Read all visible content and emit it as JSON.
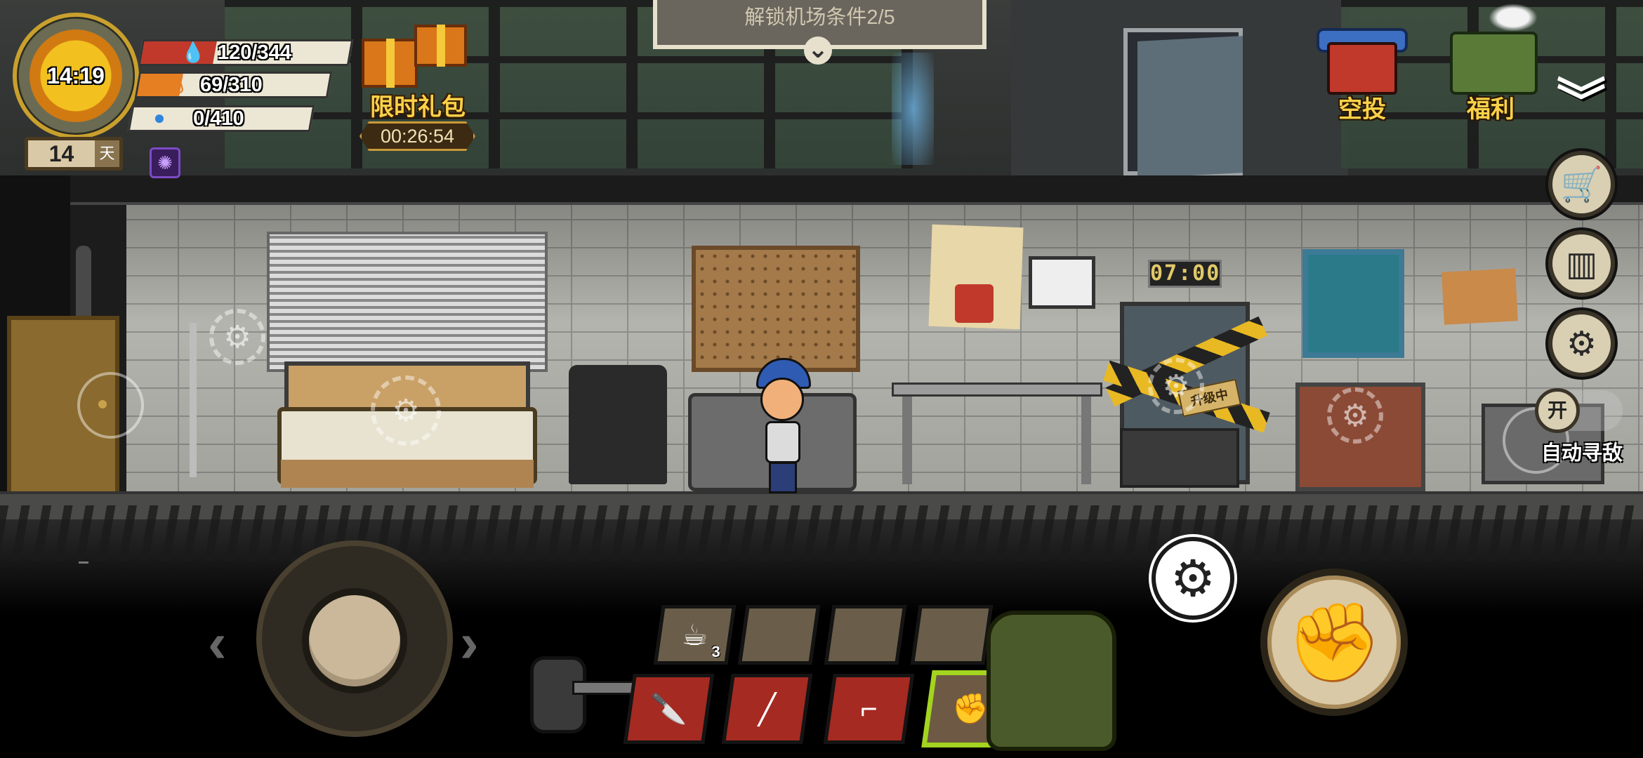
{
  "hud": {
    "clock_time": "14:19",
    "day": {
      "number": "14",
      "unit": "天"
    },
    "stats": [
      {
        "name": "health",
        "value": "120/344",
        "fraction": 0.349,
        "color": "#c0392b",
        "icon": "blood-drop-icon"
      },
      {
        "name": "hunger",
        "value": "69/310",
        "fraction": 0.223,
        "color": "#e67e22",
        "icon": "stomach-icon"
      },
      {
        "name": "thirst",
        "value": "0/410",
        "fraction": 0.0,
        "color": "#2e86de",
        "icon": "water-icon"
      }
    ],
    "brain_badge_icon": "brain-icon"
  },
  "gift": {
    "label": "限时礼包",
    "timer": "00:26:54"
  },
  "quest": {
    "text": "解锁机场条件2/5"
  },
  "right_hud": {
    "airdrop_label": "空投",
    "welfare_label": "福利",
    "side_buttons": [
      "shop-cart-icon",
      "leaderboard-icon",
      "settings-gear-icon"
    ]
  },
  "room": {
    "clock_display": "07:00",
    "upgrade_sign": "升级中"
  },
  "auto_attack": {
    "toggle_label": "开",
    "label": "自动寻敌"
  },
  "hotbar": {
    "top_slots": [
      {
        "icon": "coffee-cup-icon",
        "count": "3"
      },
      {
        "icon": "",
        "count": ""
      },
      {
        "icon": "",
        "count": ""
      },
      {
        "icon": "",
        "count": ""
      }
    ],
    "weapon_slots": [
      {
        "icon": "knife-icon"
      },
      {
        "icon": "club-icon"
      },
      {
        "icon": "shotgun-icon"
      },
      {
        "icon": "fist-icon",
        "selected": true
      }
    ]
  }
}
